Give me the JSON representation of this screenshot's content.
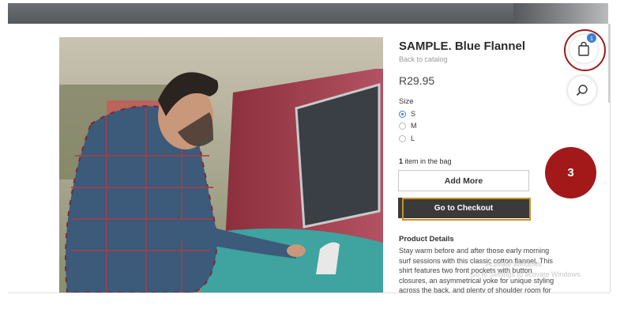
{
  "product": {
    "title": "SAMPLE. Blue Flannel",
    "back_link": "Back to catalog",
    "price": "R29.95",
    "photo_alt": "Man in flannel shirt beside van with surfboard"
  },
  "size": {
    "label": "Size",
    "options": [
      "S",
      "M",
      "L"
    ],
    "selected": "S"
  },
  "bag": {
    "count": "1",
    "count_suffix": " item in the bag",
    "badge": "1"
  },
  "buttons": {
    "add_more": "Add More",
    "checkout": "Go to Checkout"
  },
  "details": {
    "title": "Product Details",
    "text": "Stay warm before and after those early morning surf sessions with this classic cotton flannel. This shirt features two front pockets with button closures, an asymmetrical yoke for unique styling across the back, and plenty of shoulder room for"
  },
  "overlay": {
    "step_number": "3",
    "watermark_line1": "Activate Windows",
    "watermark_line2": "Go to Settings to activate Windows."
  },
  "icons": {
    "bag": "shopping-bag-icon",
    "search": "search-icon"
  },
  "colors": {
    "accent_blue": "#3c7fd6",
    "checkout_bg": "#3a3a3a",
    "annotation_red": "#a31919",
    "highlight_gold": "#c8922a"
  }
}
